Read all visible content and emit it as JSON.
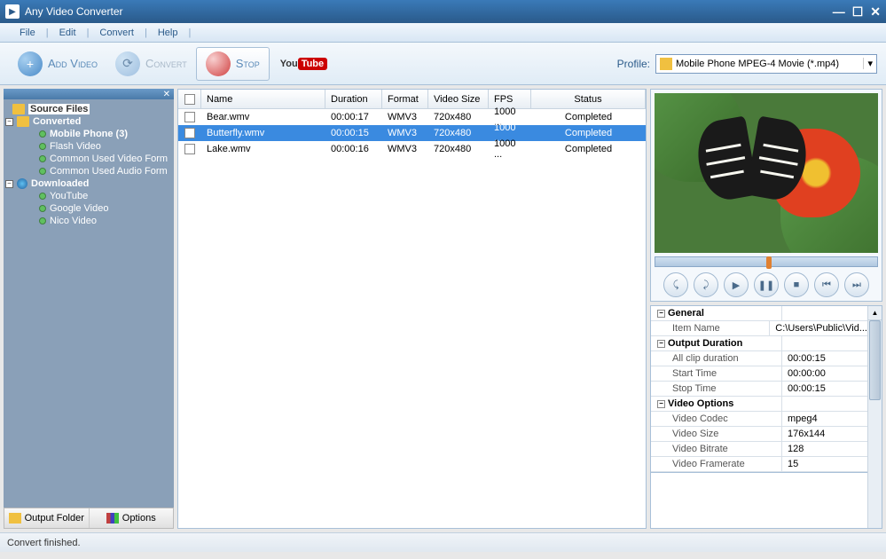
{
  "window": {
    "title": "Any Video Converter"
  },
  "menu": {
    "file": "File",
    "edit": "Edit",
    "convert": "Convert",
    "help": "Help"
  },
  "toolbar": {
    "add_video": "Add Video",
    "convert": "Convert",
    "stop": "Stop",
    "profile_label": "Profile:",
    "profile_value": "Mobile Phone MPEG-4 Movie (*.mp4)"
  },
  "tree": {
    "source_files": "Source Files",
    "converted": "Converted",
    "mobile_phone": "Mobile Phone (3)",
    "flash_video": "Flash Video",
    "common_video": "Common Used Video Form",
    "common_audio": "Common Used Audio Form",
    "downloaded": "Downloaded",
    "youtube": "YouTube",
    "google_video": "Google Video",
    "nico_video": "Nico Video"
  },
  "sidebar_footer": {
    "output_folder": "Output Folder",
    "options": "Options"
  },
  "columns": {
    "name": "Name",
    "duration": "Duration",
    "format": "Format",
    "video_size": "Video Size",
    "fps": "FPS",
    "status": "Status"
  },
  "files": [
    {
      "name": "Bear.wmv",
      "duration": "00:00:17",
      "format": "WMV3",
      "video_size": "720x480",
      "fps": "1000 ...",
      "status": "Completed"
    },
    {
      "name": "Butterfly.wmv",
      "duration": "00:00:15",
      "format": "WMV3",
      "video_size": "720x480",
      "fps": "1000 ...",
      "status": "Completed"
    },
    {
      "name": "Lake.wmv",
      "duration": "00:00:16",
      "format": "WMV3",
      "video_size": "720x480",
      "fps": "1000 ...",
      "status": "Completed"
    }
  ],
  "props": {
    "general": "General",
    "item_name_k": "Item Name",
    "item_name_v": "C:\\Users\\Public\\Vid...",
    "output_duration": "Output Duration",
    "all_clip_k": "All clip duration",
    "all_clip_v": "00:00:15",
    "start_time_k": "Start Time",
    "start_time_v": "00:00:00",
    "stop_time_k": "Stop Time",
    "stop_time_v": "00:00:15",
    "video_options": "Video Options",
    "codec_k": "Video Codec",
    "codec_v": "mpeg4",
    "vsize_k": "Video Size",
    "vsize_v": "176x144",
    "bitrate_k": "Video Bitrate",
    "bitrate_v": "128",
    "framerate_k": "Video Framerate",
    "framerate_v": "15"
  },
  "status": "Convert finished."
}
